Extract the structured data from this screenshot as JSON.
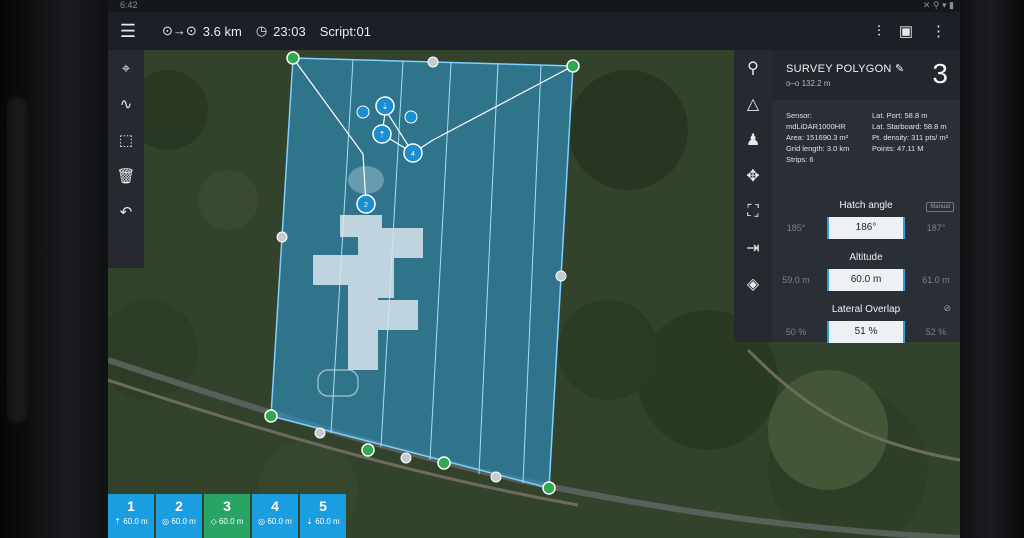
{
  "status": {
    "time": "6:42",
    "icons": "✕ ⚲ ▾ ▮"
  },
  "topbar": {
    "menu_icon": "hamburger-menu-icon",
    "distance": "3.6 km",
    "time_left": "23:03",
    "script": "Script:01"
  },
  "left_tools": [
    "location-pin-icon",
    "waveform-icon",
    "select-area-icon",
    "trash-icon",
    "undo-icon"
  ],
  "right_tools": [
    "search-icon",
    "navigation-arrow-icon",
    "pilot-icon",
    "drone-icon",
    "fit-view-icon",
    "exit-icon",
    "layers-icon"
  ],
  "panel": {
    "title": "SURVEY POLYGON",
    "subtitle": "o–o 132.2 m",
    "index": "3",
    "info_left": [
      "Sensor:",
      "mdLiDAR1000HR",
      "Area: 151690.3 m²",
      "Grid length: 3.0 km",
      "Strips: 6"
    ],
    "info_right": [
      "Lat. Port: 58.8 m",
      "Lat. Starboard: 58.8 m",
      "Pt. density: 311 pts/ m²",
      "Points: 47.11 M"
    ],
    "hatch": {
      "label": "Hatch angle",
      "badge": "Manual",
      "prev": "185°",
      "value": "186°",
      "next": "187°"
    },
    "altitude": {
      "label": "Altitude",
      "prev": "59.0 m",
      "value": "60.0 m",
      "next": "61.0 m"
    },
    "overlap": {
      "label": "Lateral Overlap",
      "prev": "50 %",
      "value": "51 %",
      "next": "52 %"
    }
  },
  "tabs": [
    {
      "n": "1",
      "alt": "⇡ 60.0 m"
    },
    {
      "n": "2",
      "alt": "◎ 60.0 m"
    },
    {
      "n": "3",
      "alt": "◇ 60.0 m"
    },
    {
      "n": "4",
      "alt": "◎ 60.0 m"
    },
    {
      "n": "5",
      "alt": "⇣ 60.0 m"
    }
  ],
  "colors": {
    "polygon": "#2e93c7",
    "tab": "#1b9ee0",
    "tab_active": "#28a565",
    "vertex": "#2fa84f"
  }
}
